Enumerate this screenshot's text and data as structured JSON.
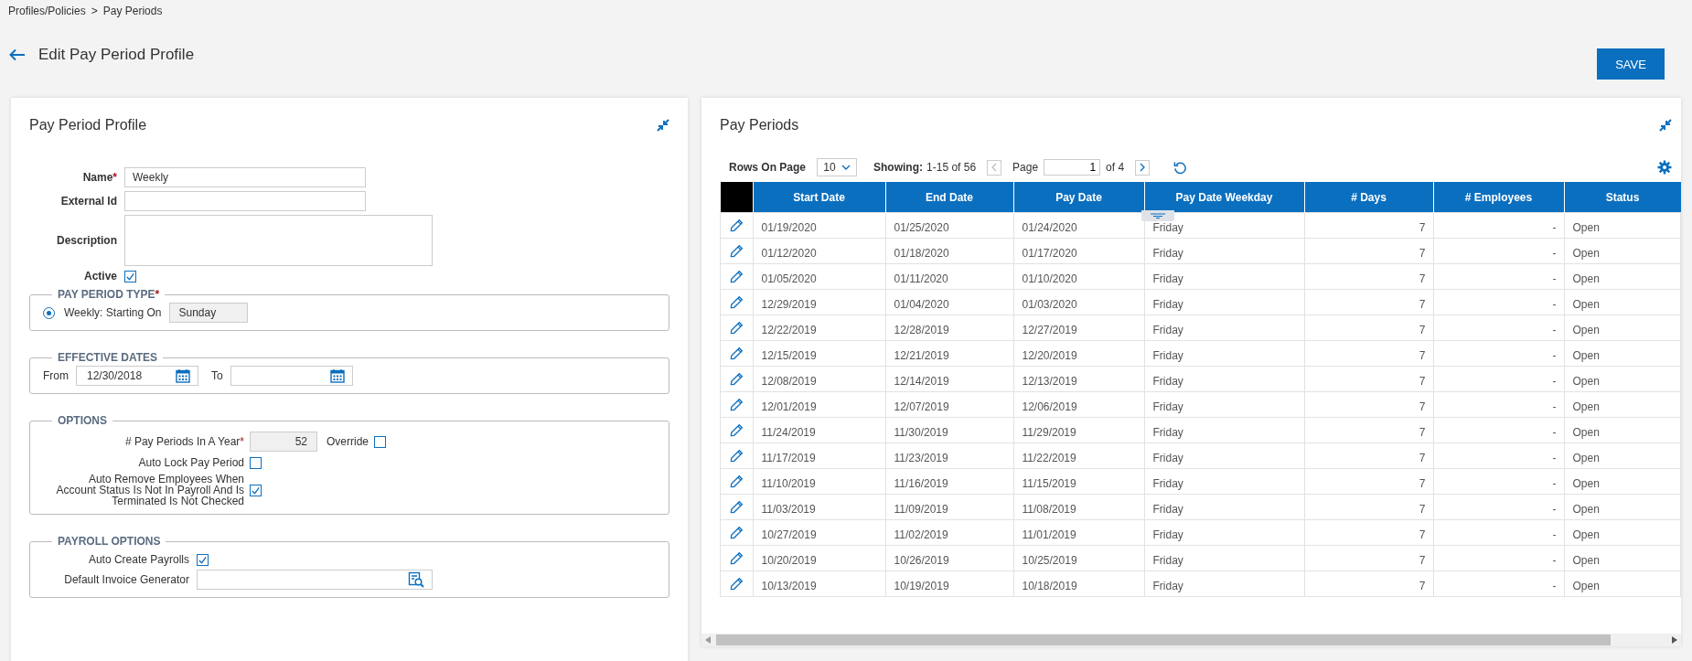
{
  "breadcrumb": [
    "Profiles/Policies",
    ">",
    "Pay Periods"
  ],
  "page_title": "Edit Pay Period Profile",
  "save_button": "SAVE",
  "profile_panel": {
    "title": "Pay Period Profile",
    "name": {
      "label": "Name",
      "required_mark": "*",
      "value": "Weekly"
    },
    "external_id": {
      "label": "External Id"
    },
    "description": {
      "label": "Description"
    },
    "active": {
      "label": "Active",
      "checked": true
    },
    "pay_period_type": {
      "legend": "PAY PERIOD TYPE",
      "required_mark": "*",
      "option": {
        "label": "Weekly: Starting On",
        "selected": true,
        "value": "Sunday"
      }
    },
    "effective_dates": {
      "legend": "EFFECTIVE DATES",
      "from_label": "From",
      "from_value": "12/30/2018",
      "to_label": "To"
    },
    "options": {
      "legend": "OPTIONS",
      "rows": [
        {
          "kind": "number",
          "label": "# Pay Periods In A Year",
          "required_mark": "*",
          "value": "52",
          "extra_label": "Override",
          "extra_checked": false
        },
        {
          "kind": "check",
          "label": "Auto Lock Pay Period",
          "checked": false
        },
        {
          "kind": "check",
          "label": "Auto Remove Employees When Account Status Is Not In Payroll And Is Terminated Is Not Checked",
          "checked": true
        }
      ]
    },
    "payroll_options": {
      "legend": "PAYROLL OPTIONS",
      "auto_create": {
        "label": "Auto Create Payrolls",
        "checked": true
      },
      "invoice_generator": {
        "label": "Default Invoice Generator"
      }
    }
  },
  "periods_panel": {
    "title": "Pay Periods",
    "rows_on_page_label": "Rows On Page",
    "rows_on_page": "10",
    "showing_label": "Showing:",
    "showing": "1-15 of 56",
    "page_label": "Page",
    "page": "1",
    "of_pages": "of 4",
    "table": {
      "columns": [
        "Start Date",
        "End Date",
        "Pay Date",
        "Pay Date Weekday",
        "# Days",
        "# Employees",
        "Status"
      ],
      "rows": [
        [
          "01/19/2020",
          "01/25/2020",
          "01/24/2020",
          "Friday",
          "7",
          "-",
          "Open"
        ],
        [
          "01/12/2020",
          "01/18/2020",
          "01/17/2020",
          "Friday",
          "7",
          "-",
          "Open"
        ],
        [
          "01/05/2020",
          "01/11/2020",
          "01/10/2020",
          "Friday",
          "7",
          "-",
          "Open"
        ],
        [
          "12/29/2019",
          "01/04/2020",
          "01/03/2020",
          "Friday",
          "7",
          "-",
          "Open"
        ],
        [
          "12/22/2019",
          "12/28/2019",
          "12/27/2019",
          "Friday",
          "7",
          "-",
          "Open"
        ],
        [
          "12/15/2019",
          "12/21/2019",
          "12/20/2019",
          "Friday",
          "7",
          "-",
          "Open"
        ],
        [
          "12/08/2019",
          "12/14/2019",
          "12/13/2019",
          "Friday",
          "7",
          "-",
          "Open"
        ],
        [
          "12/01/2019",
          "12/07/2019",
          "12/06/2019",
          "Friday",
          "7",
          "-",
          "Open"
        ],
        [
          "11/24/2019",
          "11/30/2019",
          "11/29/2019",
          "Friday",
          "7",
          "-",
          "Open"
        ],
        [
          "11/17/2019",
          "11/23/2019",
          "11/22/2019",
          "Friday",
          "7",
          "-",
          "Open"
        ],
        [
          "11/10/2019",
          "11/16/2019",
          "11/15/2019",
          "Friday",
          "7",
          "-",
          "Open"
        ],
        [
          "11/03/2019",
          "11/09/2019",
          "11/08/2019",
          "Friday",
          "7",
          "-",
          "Open"
        ],
        [
          "10/27/2019",
          "11/02/2019",
          "11/01/2019",
          "Friday",
          "7",
          "-",
          "Open"
        ],
        [
          "10/20/2019",
          "10/26/2019",
          "10/25/2019",
          "Friday",
          "7",
          "-",
          "Open"
        ],
        [
          "10/13/2019",
          "10/19/2019",
          "10/18/2019",
          "Friday",
          "7",
          "-",
          "Open"
        ]
      ]
    }
  }
}
